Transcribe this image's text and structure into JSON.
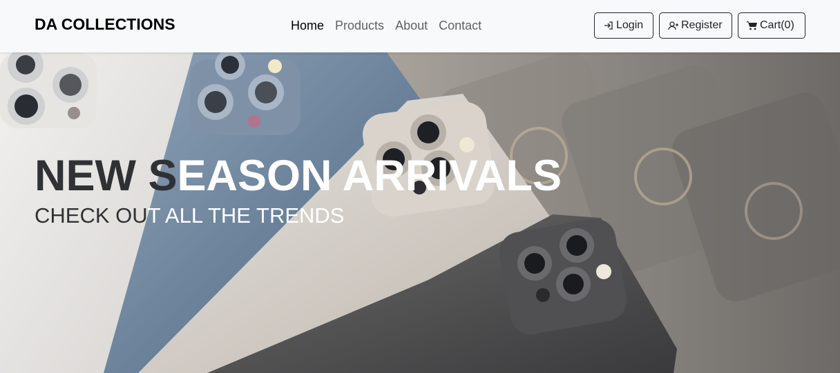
{
  "brand": "DA COLLECTIONS",
  "nav": {
    "links": [
      {
        "label": "Home",
        "active": true
      },
      {
        "label": "Products",
        "active": false
      },
      {
        "label": "About",
        "active": false
      },
      {
        "label": "Contact",
        "active": false
      }
    ]
  },
  "buttons": {
    "login": {
      "label": "Login",
      "icon": "login-icon"
    },
    "register": {
      "label": "Register",
      "icon": "user-plus-icon"
    },
    "cart": {
      "label": "Cart(0)",
      "icon": "cart-icon"
    }
  },
  "hero": {
    "title_dark": "NEW S",
    "title_light": "EASON ARRIVALS",
    "subtitle_dark": "CHECK OU",
    "subtitle_light": "T ALL THE TRENDS",
    "image": "phones-photo"
  },
  "colors": {
    "navbar_bg": "#f8f9fa",
    "text_dark": "#212529",
    "hero_text": "#ffffff"
  }
}
